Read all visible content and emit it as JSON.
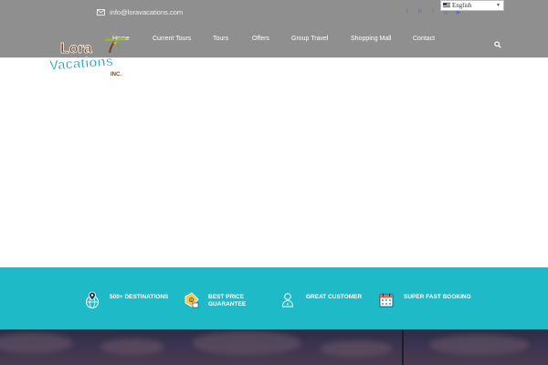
{
  "topbar": {
    "email": "info@loravacations.com",
    "social_icons": [
      "facebook-icon",
      "linkedin-icon",
      "twitter-icon",
      "instagram-icon",
      "youtube-icon"
    ],
    "language": "English"
  },
  "nav": {
    "items": [
      {
        "label": "Home"
      },
      {
        "label": "Current Tours"
      },
      {
        "label": "Tours"
      },
      {
        "label": "Offers"
      },
      {
        "label": "Group Travel"
      },
      {
        "label": "Shopping Mall"
      },
      {
        "label": "Contact"
      }
    ],
    "search_icon": "search-icon"
  },
  "logo": {
    "line1": "Lora",
    "line2": "Vacations",
    "suffix": "INC."
  },
  "features": [
    {
      "label": "500+ DESTINATIONS",
      "icon": "globe-pin-icon"
    },
    {
      "label": "BEST PRICE GUARANTEE",
      "icon": "price-tag-icon"
    },
    {
      "label": "GREAT CUSTOMER",
      "icon": "customer-icon"
    },
    {
      "label": "SUPER FAST BOOKING",
      "icon": "calendar-icon"
    }
  ],
  "colors": {
    "header_bg": "#8f8f8f",
    "features_bg": "#1fbac8",
    "hero_bg": "#3c3350"
  }
}
